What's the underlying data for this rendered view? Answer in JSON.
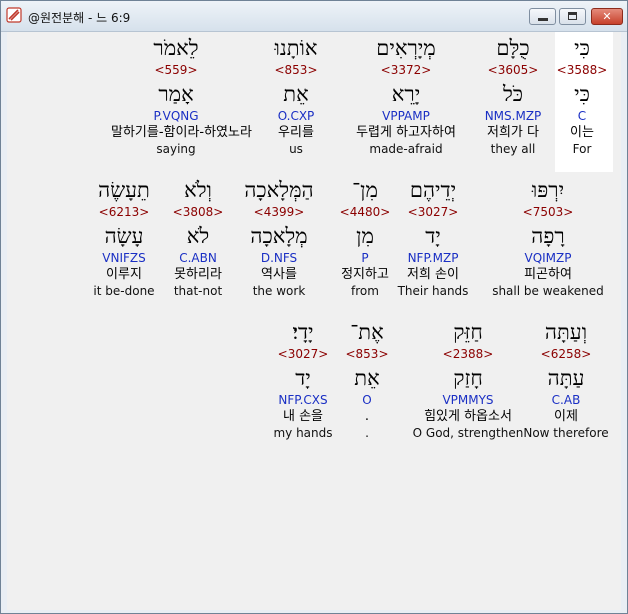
{
  "window": {
    "title": "@원전분해 - 느 6:9"
  },
  "rows": [
    [
      {
        "heb": "כִּי",
        "strong": "<3588>",
        "lemma": "כִּי",
        "morph": "C",
        "kor": "이는",
        "eng": "For"
      },
      {
        "heb": "כֻלָּם",
        "strong": "<3605>",
        "lemma": "כֹּל",
        "morph": "NMS.MZP",
        "kor": "저희가 다",
        "eng": "they all"
      },
      {
        "heb": "מְיָרְאִים",
        "strong": "<3372>",
        "lemma": "יָרֵא",
        "morph": "VPPAMP",
        "kor": "두렵게 하고자하여",
        "eng": "made-afraid"
      },
      {
        "heb": "אוֹתָנוּ",
        "strong": "<853>",
        "lemma": "אֵת",
        "morph": "O.CXP",
        "kor": "우리를",
        "eng": "us"
      },
      {
        "heb": "לֵאמֹר",
        "strong": "<559>",
        "lemma": "אָמַר",
        "morph": "P.VQNG",
        "kor": "말하기를-함이라-하였노라",
        "eng": "saying"
      }
    ],
    [
      {
        "heb": "יִרְפּוּ",
        "strong": "<7503>",
        "lemma": "רָפָה",
        "morph": "VQIMZP",
        "kor": "피곤하여",
        "eng": "shall be weakened"
      },
      {
        "heb": "יְדֵיהֶם",
        "strong": "<3027>",
        "lemma": "יָד",
        "morph": "NFP.MZP",
        "kor": "저희 손이",
        "eng": "Their hands"
      },
      {
        "heb": "מִן־",
        "strong": "<4480>",
        "lemma": "מִן",
        "morph": "P",
        "kor": "정지하고",
        "eng": "from"
      },
      {
        "heb": "הַמְּלָאכָה",
        "strong": "<4399>",
        "lemma": "מְלָאכָה",
        "morph": "D.NFS",
        "kor": "역사를",
        "eng": "the work"
      },
      {
        "heb": "וְלֹא",
        "strong": "<3808>",
        "lemma": "לֹא",
        "morph": "C.ABN",
        "kor": "못하리라",
        "eng": "that-not"
      },
      {
        "heb": "תֵעָשֶׂה",
        "strong": "<6213>",
        "lemma": "עָשָׂה",
        "morph": "VNIFZS",
        "kor": "이루지",
        "eng": "it be-done"
      }
    ],
    [
      {
        "heb": "וְעַתָּה",
        "strong": "<6258>",
        "lemma": "עַתָּה",
        "morph": "C.AB",
        "kor": "이제",
        "eng": "Now therefore"
      },
      {
        "heb": "חַזֵּק",
        "strong": "<2388>",
        "lemma": "חָזַק",
        "morph": "VPMMYS",
        "kor": "힘있게 하옵소서",
        "eng": "O God, strengthen"
      },
      {
        "heb": "אֶת־",
        "strong": "<853>",
        "lemma": "אֵת",
        "morph": "O",
        "kor": ".",
        "eng": "."
      },
      {
        "heb": "יָדָי׃",
        "strong": "<3027>",
        "lemma": "יָד",
        "morph": "NFP.CXS",
        "kor": "내 손을",
        "eng": "my hands"
      }
    ]
  ]
}
